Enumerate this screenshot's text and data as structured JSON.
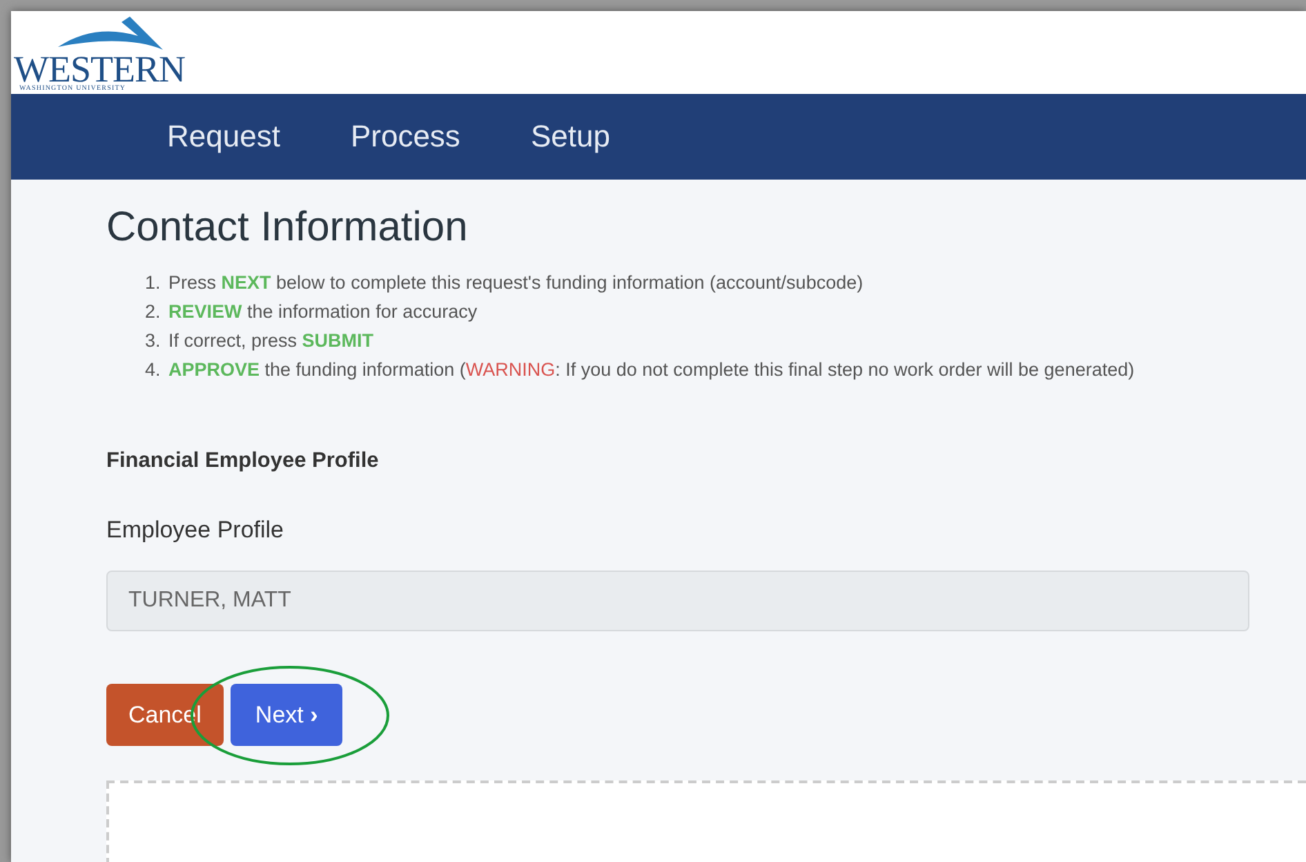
{
  "logo": {
    "name": "WESTERN",
    "subtitle": "WASHINGTON UNIVERSITY"
  },
  "nav": [
    {
      "label": "Request"
    },
    {
      "label": "Process"
    },
    {
      "label": "Setup"
    }
  ],
  "title": "Contact Information",
  "steps": [
    {
      "number": "1.",
      "segments": [
        {
          "kind": "plain",
          "text": "Press "
        },
        {
          "kind": "keyword",
          "text": "NEXT"
        },
        {
          "kind": "plain",
          "text": " below to complete this request's funding information (account/subcode)"
        }
      ]
    },
    {
      "number": "2.",
      "segments": [
        {
          "kind": "keyword",
          "text": "REVIEW"
        },
        {
          "kind": "plain",
          "text": " the information for accuracy"
        }
      ]
    },
    {
      "number": "3.",
      "segments": [
        {
          "kind": "plain",
          "text": "If correct, press "
        },
        {
          "kind": "keyword",
          "text": "SUBMIT"
        }
      ]
    },
    {
      "number": "4.",
      "segments": [
        {
          "kind": "keyword",
          "text": "APPROVE"
        },
        {
          "kind": "plain",
          "text": " the funding information ("
        },
        {
          "kind": "warning",
          "text": "WARNING"
        },
        {
          "kind": "plain",
          "text": ": If you do not complete this final step no work order will be generated)"
        }
      ]
    }
  ],
  "section_heading": "Financial Employee Profile",
  "field": {
    "label": "Employee Profile",
    "value": "TURNER, MATT",
    "disabled": true
  },
  "buttons": [
    {
      "kind": "cancel",
      "label": "Cancel",
      "highlighted": false
    },
    {
      "kind": "next",
      "label": "Next",
      "icon": "›",
      "highlighted": true
    }
  ]
}
